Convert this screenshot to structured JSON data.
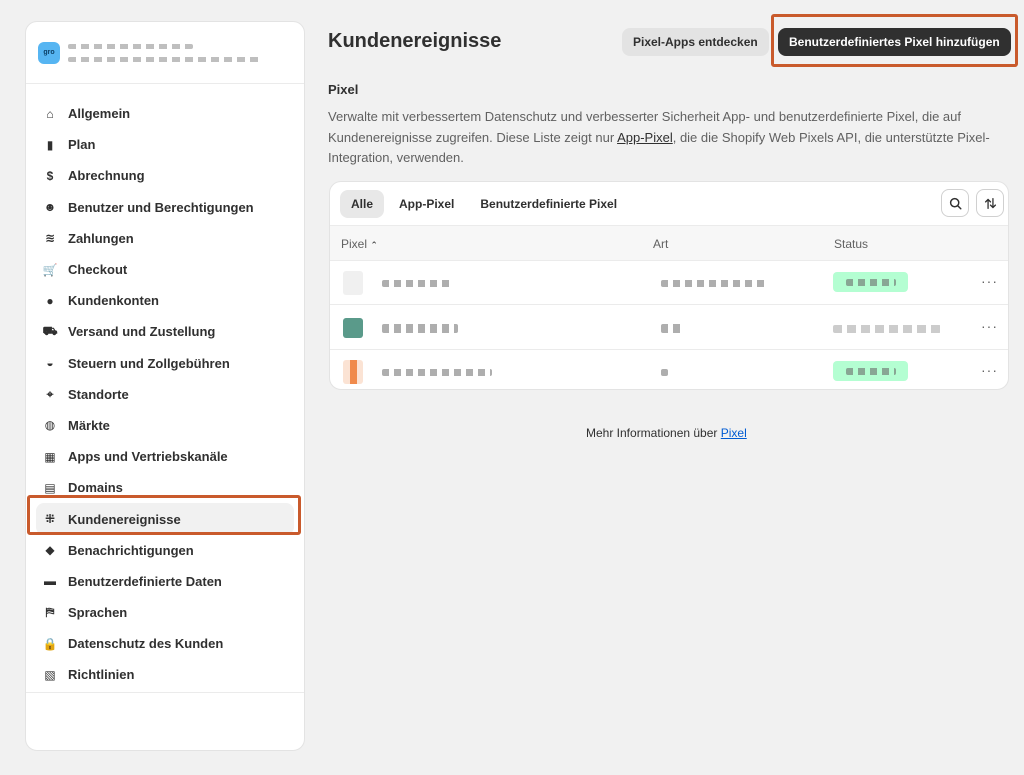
{
  "store": {
    "avatar_text": "gro"
  },
  "sidebar": {
    "items": [
      {
        "label": "Allgemein",
        "icon": "store-icon",
        "glyph": "⌂"
      },
      {
        "label": "Plan",
        "icon": "plan-chart-icon",
        "glyph": "▮"
      },
      {
        "label": "Abrechnung",
        "icon": "billing-icon",
        "glyph": "$"
      },
      {
        "label": "Benutzer und Berechtigungen",
        "icon": "users-icon",
        "glyph": "☻"
      },
      {
        "label": "Zahlungen",
        "icon": "payments-icon",
        "glyph": "≋"
      },
      {
        "label": "Checkout",
        "icon": "cart-icon",
        "glyph": "🛒"
      },
      {
        "label": "Kundenkonten",
        "icon": "person-icon",
        "glyph": "●"
      },
      {
        "label": "Versand und Zustellung",
        "icon": "truck-icon",
        "glyph": "⛟"
      },
      {
        "label": "Steuern und Zollgebühren",
        "icon": "tax-bag-icon",
        "glyph": "◒"
      },
      {
        "label": "Standorte",
        "icon": "location-pin-icon",
        "glyph": "⌖"
      },
      {
        "label": "Märkte",
        "icon": "globe-icon",
        "glyph": "◍"
      },
      {
        "label": "Apps und Vertriebskanäle",
        "icon": "apps-icon",
        "glyph": "▦"
      },
      {
        "label": "Domains",
        "icon": "domain-icon",
        "glyph": "▤"
      },
      {
        "label": "Kundenereignisse",
        "icon": "cursor-click-icon",
        "glyph": "⁜"
      },
      {
        "label": "Benachrichtigungen",
        "icon": "bell-icon",
        "glyph": "◆"
      },
      {
        "label": "Benutzerdefinierte Daten",
        "icon": "metafields-icon",
        "glyph": "▬"
      },
      {
        "label": "Sprachen",
        "icon": "language-icon",
        "glyph": "⛿"
      },
      {
        "label": "Datenschutz des Kunden",
        "icon": "lock-icon",
        "glyph": "🔒"
      },
      {
        "label": "Richtlinien",
        "icon": "policy-icon",
        "glyph": "▧"
      }
    ],
    "active_index": 13
  },
  "header": {
    "title": "Kundenereignisse",
    "secondary_button": "Pixel-Apps entdecken",
    "primary_button": "Benutzerdefiniertes Pixel hinzufügen"
  },
  "section": {
    "title": "Pixel",
    "description_pre": "Verwalte mit verbessertem Datenschutz und verbesserter Sicherheit App- und benutzerdefinierte Pixel, die auf Kundenereignisse zugreifen. Diese Liste zeigt nur ",
    "description_link": "App-Pixel",
    "description_post": ", die die Shopify Web Pixels API, die unterstützte Pixel-Integration, verwenden."
  },
  "table": {
    "tabs": [
      "Alle",
      "App-Pixel",
      "Benutzerdefinierte Pixel"
    ],
    "columns": {
      "pixel": "Pixel",
      "art": "Art",
      "status": "Status"
    },
    "more_label": "···"
  },
  "footer": {
    "text": "Mehr Informationen über ",
    "link": "Pixel"
  },
  "colors": {
    "highlight": "#c95a2c",
    "primary_button": "#303030",
    "status_green": "#b4fed2",
    "link": "#005bd3"
  }
}
